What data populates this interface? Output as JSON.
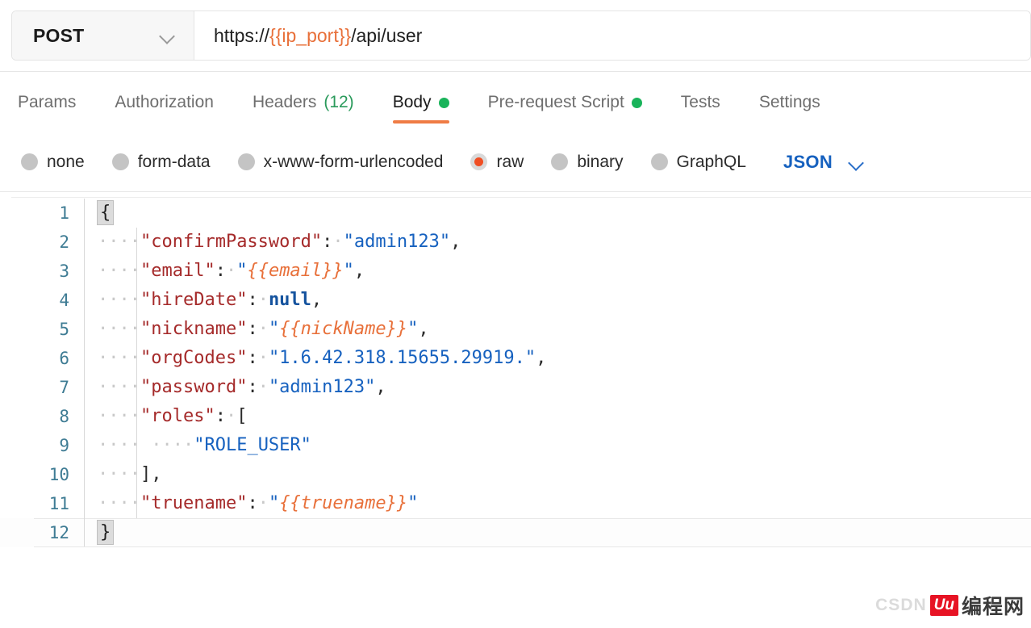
{
  "request_bar": {
    "method": "POST",
    "method_chevron_icon": "chevron-down-icon",
    "url_prefix": "https://",
    "url_variable": "{{ip_port}}",
    "url_suffix": "/api/user"
  },
  "tabs": [
    {
      "label": "Params",
      "active": false,
      "count": "",
      "dot": false
    },
    {
      "label": "Authorization",
      "active": false,
      "count": "",
      "dot": false
    },
    {
      "label": "Headers",
      "active": false,
      "count": "(12)",
      "dot": false
    },
    {
      "label": "Body",
      "active": true,
      "count": "",
      "dot": true
    },
    {
      "label": "Pre-request Script",
      "active": false,
      "count": "",
      "dot": true
    },
    {
      "label": "Tests",
      "active": false,
      "count": "",
      "dot": false
    },
    {
      "label": "Settings",
      "active": false,
      "count": "",
      "dot": false
    }
  ],
  "body_types": {
    "options": [
      {
        "label": "none",
        "selected": false
      },
      {
        "label": "form-data",
        "selected": false
      },
      {
        "label": "x-www-form-urlencoded",
        "selected": false
      },
      {
        "label": "raw",
        "selected": true
      },
      {
        "label": "binary",
        "selected": false
      },
      {
        "label": "GraphQL",
        "selected": false
      }
    ],
    "format_label": "JSON",
    "format_chevron_icon": "chevron-down-icon"
  },
  "editor": {
    "lines": [
      {
        "num": "1",
        "indent": "",
        "current": false,
        "guide": false,
        "tokens": [
          {
            "t": "brace-hl",
            "v": "{"
          }
        ]
      },
      {
        "num": "2",
        "indent": "····",
        "current": false,
        "guide": true,
        "tokens": [
          {
            "t": "k",
            "v": "\"confirmPassword\""
          },
          {
            "t": "p",
            "v": ":"
          },
          {
            "t": "ws",
            "v": "·"
          },
          {
            "t": "s",
            "v": "\"admin123\""
          },
          {
            "t": "p",
            "v": ","
          }
        ]
      },
      {
        "num": "3",
        "indent": "····",
        "current": false,
        "guide": true,
        "tokens": [
          {
            "t": "k",
            "v": "\"email\""
          },
          {
            "t": "p",
            "v": ":"
          },
          {
            "t": "ws",
            "v": "·"
          },
          {
            "t": "s",
            "v": "\""
          },
          {
            "t": "tv",
            "v": "{{email}}"
          },
          {
            "t": "s",
            "v": "\""
          },
          {
            "t": "p",
            "v": ","
          }
        ]
      },
      {
        "num": "4",
        "indent": "····",
        "current": false,
        "guide": true,
        "tokens": [
          {
            "t": "k",
            "v": "\"hireDate\""
          },
          {
            "t": "p",
            "v": ":"
          },
          {
            "t": "ws",
            "v": "·"
          },
          {
            "t": "n",
            "v": "null"
          },
          {
            "t": "p",
            "v": ","
          }
        ]
      },
      {
        "num": "5",
        "indent": "····",
        "current": false,
        "guide": true,
        "tokens": [
          {
            "t": "k",
            "v": "\"nickname\""
          },
          {
            "t": "p",
            "v": ":"
          },
          {
            "t": "ws",
            "v": "·"
          },
          {
            "t": "s",
            "v": "\""
          },
          {
            "t": "tv",
            "v": "{{nickName}}"
          },
          {
            "t": "s",
            "v": "\""
          },
          {
            "t": "p",
            "v": ","
          }
        ]
      },
      {
        "num": "6",
        "indent": "····",
        "current": false,
        "guide": true,
        "tokens": [
          {
            "t": "k",
            "v": "\"orgCodes\""
          },
          {
            "t": "p",
            "v": ":"
          },
          {
            "t": "ws",
            "v": "·"
          },
          {
            "t": "s",
            "v": "\"1.6.42.318.15655.29919.\""
          },
          {
            "t": "p",
            "v": ","
          }
        ]
      },
      {
        "num": "7",
        "indent": "····",
        "current": false,
        "guide": true,
        "tokens": [
          {
            "t": "k",
            "v": "\"password\""
          },
          {
            "t": "p",
            "v": ":"
          },
          {
            "t": "ws",
            "v": "·"
          },
          {
            "t": "s",
            "v": "\"admin123\""
          },
          {
            "t": "p",
            "v": ","
          }
        ]
      },
      {
        "num": "8",
        "indent": "····",
        "current": false,
        "guide": true,
        "tokens": [
          {
            "t": "k",
            "v": "\"roles\""
          },
          {
            "t": "p",
            "v": ":"
          },
          {
            "t": "ws",
            "v": "·"
          },
          {
            "t": "p",
            "v": "["
          }
        ]
      },
      {
        "num": "9",
        "indent": "···· ····",
        "current": false,
        "guide": true,
        "tokens": [
          {
            "t": "s",
            "v": "\"ROLE_USER\""
          }
        ]
      },
      {
        "num": "10",
        "indent": "····",
        "current": false,
        "guide": true,
        "tokens": [
          {
            "t": "p",
            "v": "],"
          }
        ]
      },
      {
        "num": "11",
        "indent": "····",
        "current": false,
        "guide": true,
        "tokens": [
          {
            "t": "k",
            "v": "\"truename\""
          },
          {
            "t": "p",
            "v": ":"
          },
          {
            "t": "ws",
            "v": "·"
          },
          {
            "t": "s",
            "v": "\""
          },
          {
            "t": "tv",
            "v": "{{truename}}"
          },
          {
            "t": "s",
            "v": "\""
          }
        ]
      },
      {
        "num": "12",
        "indent": "",
        "current": true,
        "guide": false,
        "tokens": [
          {
            "t": "brace-hl",
            "v": "}"
          }
        ]
      }
    ]
  },
  "watermark": {
    "prefix": "CSDN",
    "logo": "Uu",
    "text": "编程网"
  }
}
